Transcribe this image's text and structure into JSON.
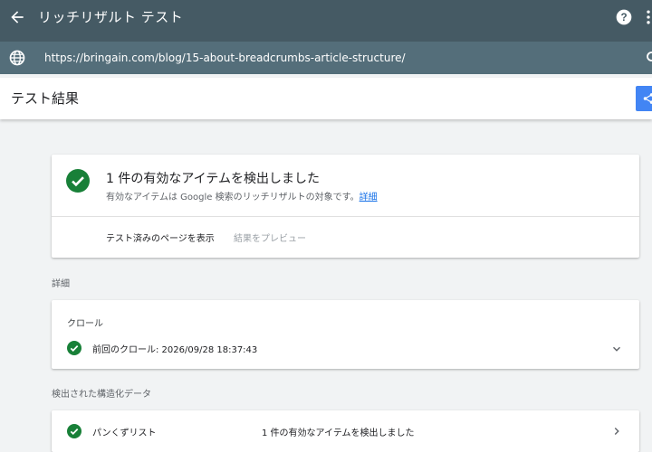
{
  "app": {
    "title": "リッチリザルト テスト",
    "url": "https://bringain.com/blog/15-about-breadcrumbs-article-structure/"
  },
  "header": {
    "title": "テスト結果"
  },
  "summary": {
    "title": "1 件の有効なアイテムを検出しました",
    "subtitle": "有効なアイテムは Google 検索のリッチリザルトの対象です。",
    "details_link": "詳細",
    "view_tested_page": "テスト済みのページを表示",
    "preview_results": "結果をプレビュー"
  },
  "details": {
    "section_label": "詳細",
    "crawl_heading": "クロール",
    "last_crawl": "前回のクロール: 2026/09/28 18:37:43"
  },
  "structured_data": {
    "section_label": "検出された構造化データ",
    "items": [
      {
        "name": "パンくずリスト",
        "status": "1 件の有効なアイテムを検出しました"
      }
    ]
  },
  "colors": {
    "topbar": "#455a64",
    "urlbar": "#546e7a",
    "success": "#188038",
    "accent": "#4285f4",
    "link": "#1a73e8"
  },
  "icons": [
    "back-arrow-icon",
    "help-icon",
    "more-vert-icon",
    "globe-icon",
    "search-icon",
    "share-icon",
    "check-circle-icon",
    "chevron-down-icon",
    "chevron-right-icon"
  ]
}
